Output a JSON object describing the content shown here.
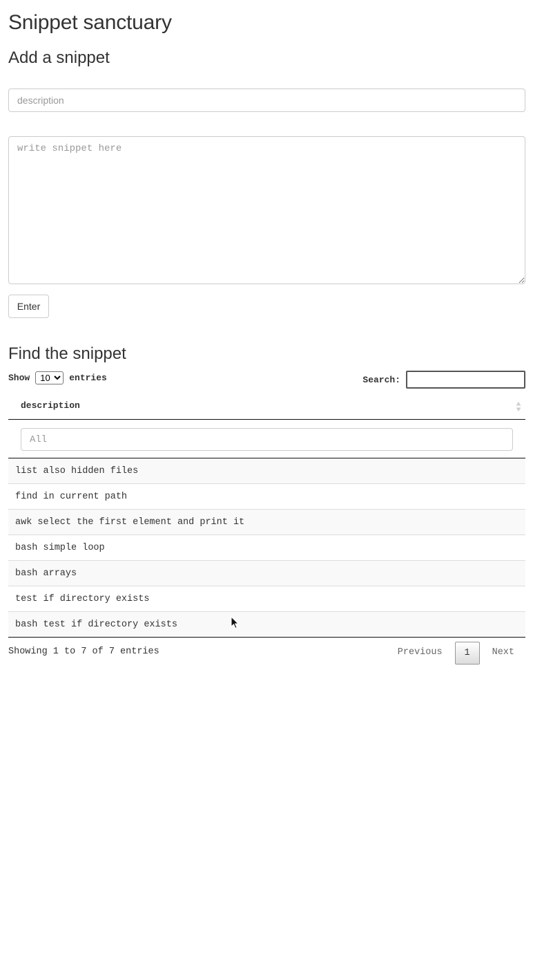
{
  "app": {
    "title": "Snippet sanctuary"
  },
  "add_section": {
    "heading": "Add a snippet",
    "description_placeholder": "description",
    "snippet_placeholder": "write snippet here",
    "submit_label": "Enter"
  },
  "find_section": {
    "heading": "Find the snippet",
    "length": {
      "prefix": "Show",
      "selected": "10",
      "suffix": "entries"
    },
    "search": {
      "label": "Search:",
      "value": ""
    },
    "table": {
      "column_header": "description",
      "filter_placeholder": "All",
      "rows": [
        "list also hidden files",
        "find in current path",
        "awk select the first element and print it",
        "bash simple loop",
        "bash arrays",
        "test if directory exists",
        "bash test if directory exists"
      ]
    },
    "info": "Showing 1 to 7 of 7 entries",
    "pagination": {
      "previous": "Previous",
      "current_page": "1",
      "next": "Next"
    }
  },
  "icons": {
    "sort": "sort-both-icon",
    "cursor": "mouse-pointer-icon"
  }
}
